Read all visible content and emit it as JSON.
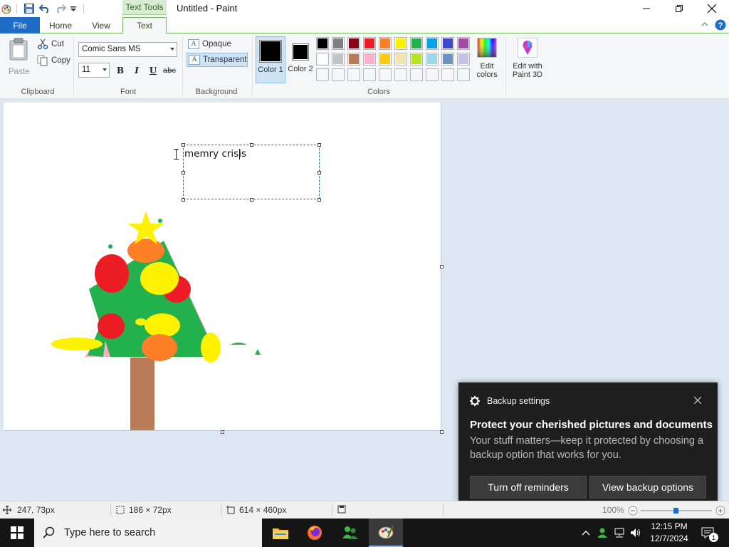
{
  "titlebar": {
    "context_tab": "Text Tools",
    "title": "Untitled - Paint"
  },
  "tabs": {
    "file": "File",
    "home": "Home",
    "view": "View",
    "text": "Text"
  },
  "clipboard": {
    "paste": "Paste",
    "cut": "Cut",
    "copy": "Copy",
    "label": "Clipboard"
  },
  "font": {
    "family": "Comic Sans MS",
    "size": "11",
    "bold": "B",
    "italic": "I",
    "underline": "U",
    "strike": "abc",
    "label": "Font"
  },
  "background": {
    "opaque": "Opaque",
    "transparent": "Transparent",
    "label": "Background",
    "selected": "Transparent"
  },
  "colors": {
    "color1_label": "Color 1",
    "color2_label": "Color 2",
    "color1": "#000000",
    "color2": "#000000",
    "edit_colors": "Edit colors",
    "paint3d": "Edit with Paint 3D",
    "label": "Colors",
    "palette_row1": [
      "#000000",
      "#7f7f7f",
      "#880015",
      "#ed1c24",
      "#ff7f27",
      "#fff200",
      "#22b14c",
      "#00a2e8",
      "#3f48cc",
      "#a349a4"
    ],
    "palette_row2": [
      "#ffffff",
      "#c3c3c3",
      "#b97a57",
      "#ffaec9",
      "#ffc90e",
      "#efe4b0",
      "#b5e61d",
      "#99d9ea",
      "#7092be",
      "#c8bfe7"
    ]
  },
  "canvas": {
    "text_content": "memry crisis"
  },
  "toast": {
    "header": "Backup settings",
    "title": "Protect your cherished pictures and documents",
    "body": "Your stuff matters—keep it protected by choosing a backup option that works for you.",
    "button_left": "Turn off reminders",
    "button_right": "View backup options"
  },
  "status": {
    "cursor_pos": "247, 73px",
    "selection_size": "186 × 72px",
    "image_size": "614 × 460px",
    "zoom": "100%"
  },
  "taskbar": {
    "search_placeholder": "Type here to search",
    "time": "12:15 PM",
    "date": "12/7/2024",
    "notification_count": "1"
  }
}
